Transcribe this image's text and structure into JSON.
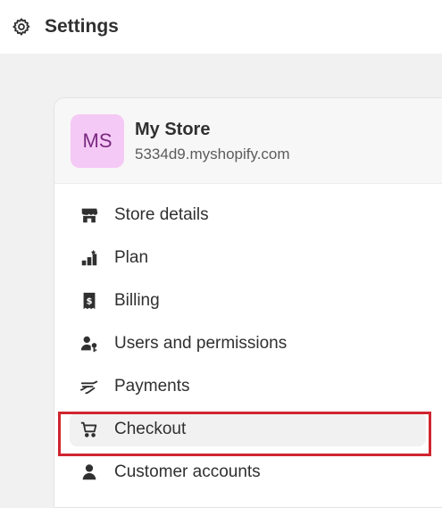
{
  "header": {
    "title": "Settings",
    "icon": "gear-icon"
  },
  "store": {
    "initials": "MS",
    "name": "My Store",
    "domain": "5334d9.myshopify.com",
    "avatar_bg": "#f5c9f5",
    "avatar_fg": "#7a2a80"
  },
  "menu": {
    "items": [
      {
        "label": "Store details",
        "icon": "store-icon"
      },
      {
        "label": "Plan",
        "icon": "plan-icon"
      },
      {
        "label": "Billing",
        "icon": "billing-icon"
      },
      {
        "label": "Users and permissions",
        "icon": "users-icon"
      },
      {
        "label": "Payments",
        "icon": "payments-icon"
      },
      {
        "label": "Checkout",
        "icon": "cart-icon",
        "selected": true
      },
      {
        "label": "Customer accounts",
        "icon": "person-icon"
      }
    ]
  },
  "highlight_color": "#d0252f"
}
